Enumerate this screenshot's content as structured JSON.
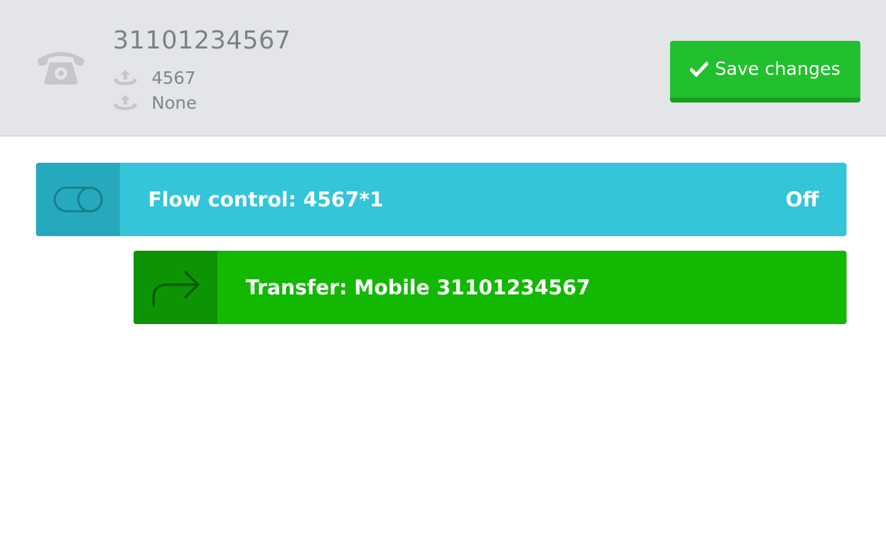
{
  "header": {
    "phone_number": "31101234567",
    "extension": "4567",
    "secondary": "None",
    "save_label": "Save changes"
  },
  "flow_control": {
    "title": "Flow control: 4567*1",
    "state": "Off",
    "color": "#33c5d9"
  },
  "transfer": {
    "title": "Transfer: Mobile 31101234567",
    "color": "#12b900"
  },
  "icons": {
    "phone": "phone-icon",
    "outgoing": "outgoing-call-icon",
    "toggle": "toggle-icon",
    "forward": "forward-arrow-icon",
    "check": "check-icon"
  }
}
